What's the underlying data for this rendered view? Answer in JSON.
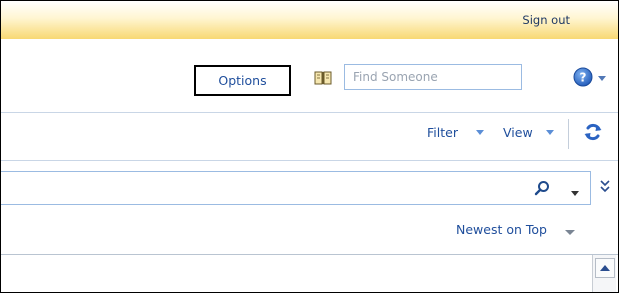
{
  "header": {
    "sign_out_label": "Sign out"
  },
  "toolbar": {
    "options_label": "Options",
    "address_book_icon": "address-book-icon",
    "find_someone_placeholder": "Find Someone",
    "help_icon": "help-icon"
  },
  "view_bar": {
    "filter_label": "Filter",
    "view_label": "View",
    "refresh_icon": "refresh-icon"
  },
  "search": {
    "search_icon": "search-icon",
    "expand_icon": "expand-icon"
  },
  "list": {
    "sort_label": "Newest on Top"
  },
  "colors": {
    "link": "#1f4e9c",
    "header_gradient_end": "#f8d873",
    "input_border": "#9bbbe2"
  }
}
